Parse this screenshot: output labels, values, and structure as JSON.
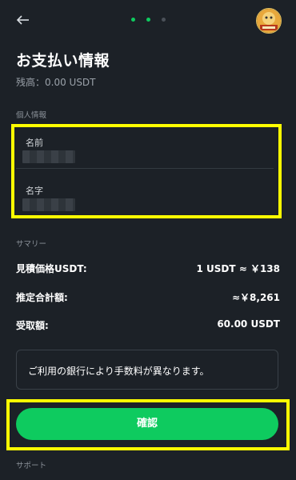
{
  "colors": {
    "background": "#1c2127",
    "accent_green": "#0ecb5f",
    "highlight_yellow": "#ffff00",
    "muted_text": "#9aa1a9"
  },
  "header": {
    "back_icon": "arrow-left-icon",
    "step_indicator": {
      "total": 3,
      "completed": 2
    }
  },
  "page": {
    "title": "お支払い情報",
    "balance": "残高：0.00 USDT"
  },
  "personal_info": {
    "section_label": "個人情報",
    "first_name_label": "名前",
    "last_name_label": "名字"
  },
  "summary": {
    "section_label": "サマリー",
    "rows": [
      {
        "label": "見積価格USDT:",
        "value": "1 USDT ≈ ￥138"
      },
      {
        "label": "推定合計額:",
        "value": "≈￥8,261"
      },
      {
        "label": "受取額:",
        "value": "60.00 USDT"
      }
    ]
  },
  "notice": "ご利用の銀行により手数料が異なります。",
  "confirm_label": "確認",
  "support_label": "サポート"
}
